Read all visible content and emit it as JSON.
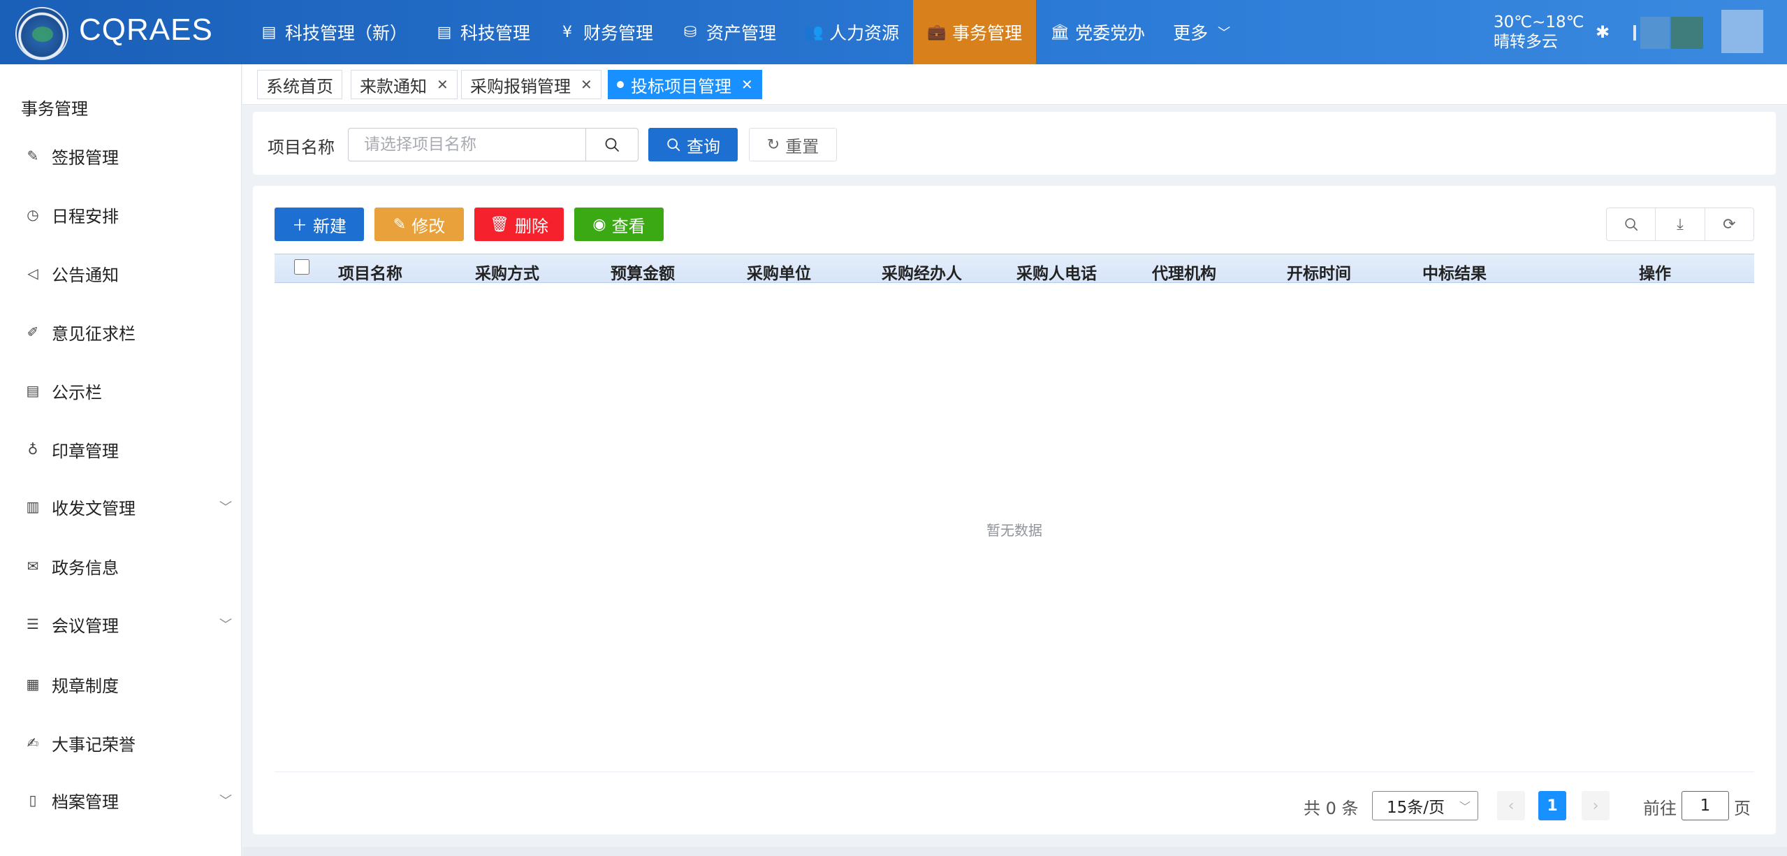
{
  "header": {
    "brand": "CQRAES",
    "nav": [
      {
        "icon": "tech-icon",
        "glyph": "▤",
        "label": "科技管理（新）",
        "active": false
      },
      {
        "icon": "tech-icon",
        "glyph": "▤",
        "label": "科技管理",
        "active": false
      },
      {
        "icon": "yen-icon",
        "glyph": "¥",
        "label": "财务管理",
        "active": false
      },
      {
        "icon": "coins-icon",
        "glyph": "⛁",
        "label": "资产管理",
        "active": false
      },
      {
        "icon": "users-icon",
        "glyph": "👥",
        "label": "人力资源",
        "active": false
      },
      {
        "icon": "briefcase-icon",
        "glyph": "💼",
        "label": "事务管理",
        "active": true
      },
      {
        "icon": "bank-icon",
        "glyph": "🏛",
        "label": "党委党办",
        "active": false
      }
    ],
    "more_label": "更多",
    "weather_temp": "30℃~18℃",
    "weather_desc": "晴转多云"
  },
  "sidebar": {
    "title": "事务管理",
    "items": [
      {
        "label": "签报管理",
        "glyph": "✎",
        "has_children": false
      },
      {
        "label": "日程安排",
        "glyph": "◷",
        "has_children": false
      },
      {
        "label": "公告通知",
        "glyph": "◁",
        "has_children": false
      },
      {
        "label": "意见征求栏",
        "glyph": "✐",
        "has_children": false
      },
      {
        "label": "公示栏",
        "glyph": "▤",
        "has_children": false
      },
      {
        "label": "印章管理",
        "glyph": "♁",
        "has_children": false
      },
      {
        "label": "收发文管理",
        "glyph": "▥",
        "has_children": true
      },
      {
        "label": "政务信息",
        "glyph": "✉",
        "has_children": false
      },
      {
        "label": "会议管理",
        "glyph": "☰",
        "has_children": true
      },
      {
        "label": "规章制度",
        "glyph": "▦",
        "has_children": false
      },
      {
        "label": "大事记荣誉",
        "glyph": "✍",
        "has_children": false
      },
      {
        "label": "档案管理",
        "glyph": "▯",
        "has_children": true
      }
    ]
  },
  "tabs": [
    {
      "label": "系统首页",
      "closable": false,
      "active": false
    },
    {
      "label": "来款通知",
      "closable": true,
      "active": false
    },
    {
      "label": "采购报销管理",
      "closable": true,
      "active": false
    },
    {
      "label": "投标项目管理",
      "closable": true,
      "active": true
    }
  ],
  "search": {
    "label": "项目名称",
    "placeholder": "请选择项目名称",
    "value": "",
    "query_label": "查询",
    "reset_label": "重置"
  },
  "toolbar": {
    "new_label": "新建",
    "edit_label": "修改",
    "delete_label": "删除",
    "view_label": "查看"
  },
  "table": {
    "columns": [
      "项目名称",
      "采购方式",
      "预算金额",
      "采购单位",
      "采购经办人",
      "采购人电话",
      "代理机构",
      "开标时间",
      "中标结果",
      "操作"
    ],
    "rows": [],
    "empty_text": "暂无数据"
  },
  "pagination": {
    "total_text": "共 0 条",
    "page_size": "15条/页",
    "current_page": "1",
    "goto_prefix": "前往",
    "goto_value": "1",
    "goto_suffix": "页"
  },
  "colors": {
    "header_bg": "#2b7ad6",
    "active_nav": "#d8811c",
    "primary": "#1d6fd1",
    "warning": "#e9a23b",
    "danger": "#f5222d",
    "success": "#3ba914",
    "active_tab": "#1890ff"
  }
}
